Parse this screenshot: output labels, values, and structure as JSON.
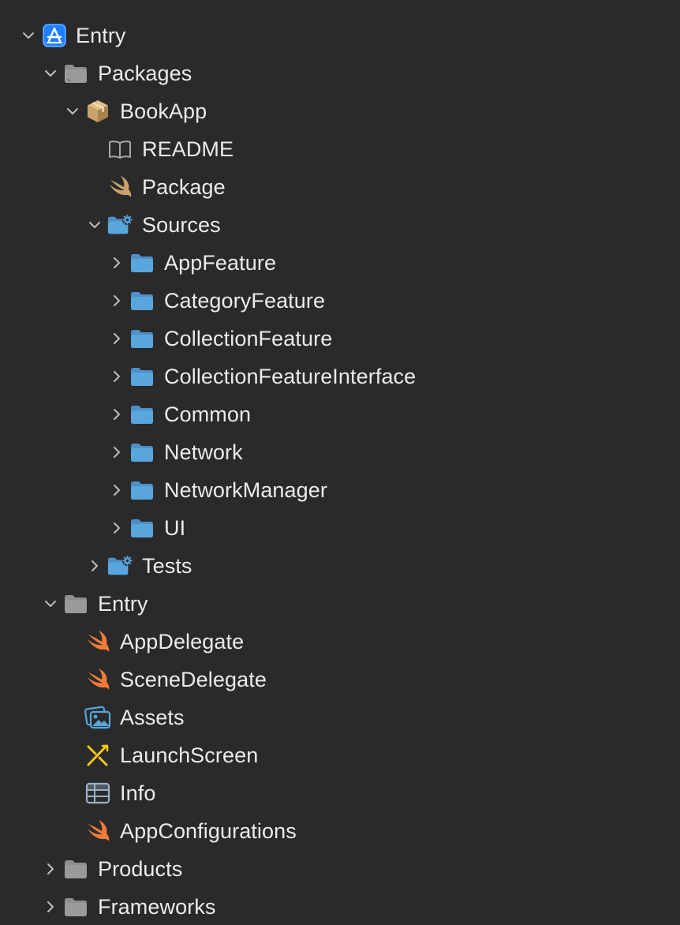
{
  "colors": {
    "background": "#2a2a2a",
    "text": "#ebebeb",
    "folder_gray": "#8e8e8e",
    "folder_blue": "#58a6dc",
    "swift_orange": "#f27b3a",
    "package_tan": "#c9a36b",
    "app_icon_blue": "#1f7fff"
  },
  "tree": {
    "root": {
      "label": "Entry",
      "icon": "xcode-project-icon",
      "expanded": true
    },
    "packages": {
      "label": "Packages",
      "icon": "group-folder-icon",
      "expanded": true
    },
    "bookapp": {
      "label": "BookApp",
      "icon": "package-box-icon",
      "expanded": true
    },
    "readme": {
      "label": "README",
      "icon": "book-icon"
    },
    "package": {
      "label": "Package",
      "icon": "swift-icon"
    },
    "sources": {
      "label": "Sources",
      "icon": "folder-gear-icon",
      "expanded": true
    },
    "source_folders": [
      {
        "label": "AppFeature",
        "icon": "folder-icon",
        "expanded": false
      },
      {
        "label": "CategoryFeature",
        "icon": "folder-icon",
        "expanded": false
      },
      {
        "label": "CollectionFeature",
        "icon": "folder-icon",
        "expanded": false
      },
      {
        "label": "CollectionFeatureInterface",
        "icon": "folder-icon",
        "expanded": false
      },
      {
        "label": "Common",
        "icon": "folder-icon",
        "expanded": false
      },
      {
        "label": "Network",
        "icon": "folder-icon",
        "expanded": false
      },
      {
        "label": "NetworkManager",
        "icon": "folder-icon",
        "expanded": false
      },
      {
        "label": "UI",
        "icon": "folder-icon",
        "expanded": false
      }
    ],
    "tests": {
      "label": "Tests",
      "icon": "folder-gear-icon",
      "expanded": false
    },
    "entry_group": {
      "label": "Entry",
      "icon": "group-folder-icon",
      "expanded": true
    },
    "entry_files": [
      {
        "label": "AppDelegate",
        "icon": "swift-icon"
      },
      {
        "label": "SceneDelegate",
        "icon": "swift-icon"
      },
      {
        "label": "Assets",
        "icon": "asset-catalog-icon"
      },
      {
        "label": "LaunchScreen",
        "icon": "storyboard-icon"
      },
      {
        "label": "Info",
        "icon": "plist-table-icon"
      },
      {
        "label": "AppConfigurations",
        "icon": "swift-icon"
      }
    ],
    "products": {
      "label": "Products",
      "icon": "group-folder-icon",
      "expanded": false
    },
    "frameworks": {
      "label": "Frameworks",
      "icon": "group-folder-icon",
      "expanded": false
    }
  }
}
